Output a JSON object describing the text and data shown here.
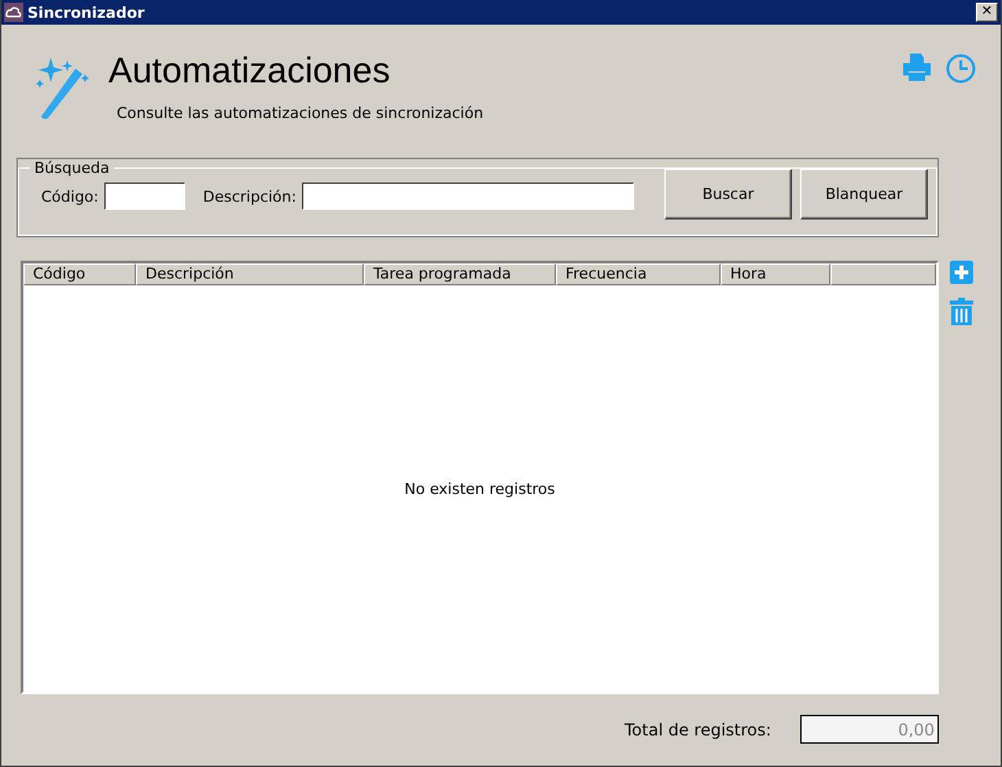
{
  "window": {
    "title": "Sincronizador",
    "close": "✕"
  },
  "header": {
    "title": "Automatizaciones",
    "subtitle": "Consulte las automatizaciones de sincronización"
  },
  "search": {
    "legend": "Búsqueda",
    "code_label": "Código:",
    "description_label": "Descripción:",
    "buttons": [
      "Buscar",
      "Blanquear"
    ]
  },
  "table": {
    "columns": [
      "Código",
      "Descripción",
      "Tarea programada",
      "Frecuencia",
      "Hora"
    ],
    "empty_message": "No existen registros"
  },
  "footer": {
    "total_label": "Total de registros:",
    "total_value": "0,00"
  }
}
